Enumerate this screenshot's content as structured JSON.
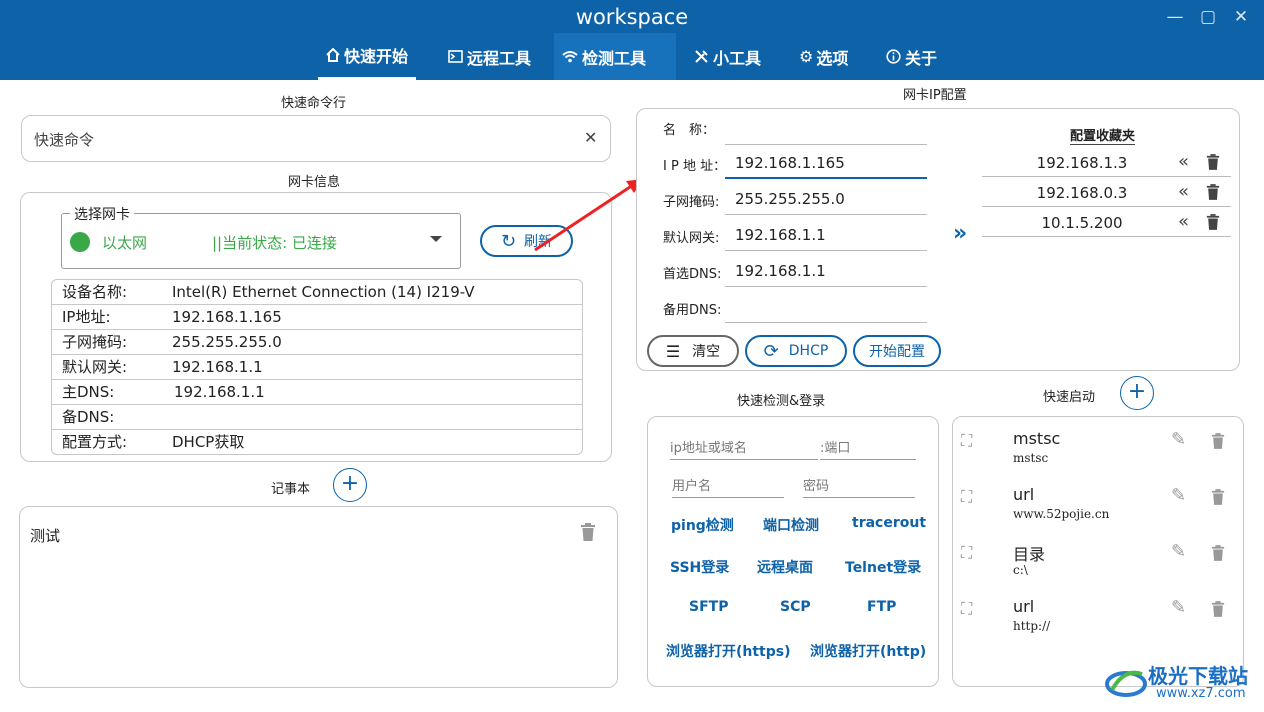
{
  "window": {
    "title": "workspace",
    "controls": [
      "—",
      "▢",
      "✕"
    ]
  },
  "tabs": [
    {
      "label": "快速开始",
      "icon": "home-icon",
      "active": true
    },
    {
      "label": "远程工具",
      "icon": "terminal-icon"
    },
    {
      "label": "检测工具",
      "icon": "wifi-icon",
      "highlighted": true
    },
    {
      "label": "小工具",
      "icon": "tools-icon"
    },
    {
      "label": "选项",
      "icon": "gear-icon"
    },
    {
      "label": "关于",
      "icon": "info-icon"
    }
  ],
  "quick_cmd": {
    "title": "快速命令行",
    "placeholder": "快速命令",
    "clear": "✕"
  },
  "nic_info": {
    "title": "网卡信息",
    "select_legend": "选择网卡",
    "adapter": "以太网",
    "state": "||当前状态: 已连接",
    "refresh_label": "刷新",
    "rows": [
      {
        "k": "设备名称:",
        "v": "Intel(R) Ethernet Connection (14) I219-V"
      },
      {
        "k": "IP地址:",
        "v": "192.168.1.165"
      },
      {
        "k": "子网掩码:",
        "v": "255.255.255.0"
      },
      {
        "k": "默认网关:",
        "v": "192.168.1.1"
      },
      {
        "k": "主DNS:",
        "v": "192.168.1.1"
      },
      {
        "k": "备DNS:",
        "v": ""
      },
      {
        "k": "配置方式:",
        "v": "DHCP获取"
      }
    ]
  },
  "notes": {
    "title": "记事本",
    "add": "+",
    "items": [
      {
        "text": "测试"
      }
    ]
  },
  "ip_config": {
    "title": "网卡IP配置",
    "fields": [
      {
        "label": "名　称：",
        "value": ""
      },
      {
        "label": "I P 地 址：",
        "value": "192.168.1.165"
      },
      {
        "label": "子网掩码:",
        "value": "255.255.255.0"
      },
      {
        "label": "默认网关:",
        "value": "192.168.1.1"
      },
      {
        "label": "首选DNS:",
        "value": "192.168.1.1"
      },
      {
        "label": "备用DNS:",
        "value": ""
      }
    ],
    "clear_label": "清空",
    "dhcp_label": "DHCP",
    "apply_label": "开始配置",
    "transfer": "»",
    "favorites_title": "配置收藏夹",
    "favorites": [
      "192.168.1.3",
      "192.168.0.3",
      "10.1.5.200"
    ]
  },
  "quick_check": {
    "title": "快速检测&登录",
    "host_placeholder": "ip地址或域名",
    "port_placeholder": ":端口",
    "user_placeholder": "用户名",
    "pass_placeholder": "密码",
    "links": [
      "ping检测",
      "端口检测",
      "tracerout",
      "SSH登录",
      "远程桌面",
      "Telnet登录",
      "SFTP",
      "SCP",
      "FTP",
      "浏览器打开(https)",
      "浏览器打开(http)"
    ]
  },
  "quick_launch": {
    "title": "快速启动",
    "add": "+",
    "items": [
      {
        "name": "mstsc",
        "path": "mstsc"
      },
      {
        "name": "url",
        "path": "www.52pojie.cn"
      },
      {
        "name": "目录",
        "path": "c:\\"
      },
      {
        "name": "url",
        "path": "http://"
      }
    ]
  },
  "watermark": {
    "text": "极光下载站",
    "url": "www.xz7.com"
  },
  "colors": {
    "primary": "#0d62a8",
    "connected": "#3aa846",
    "text": "#222222"
  }
}
